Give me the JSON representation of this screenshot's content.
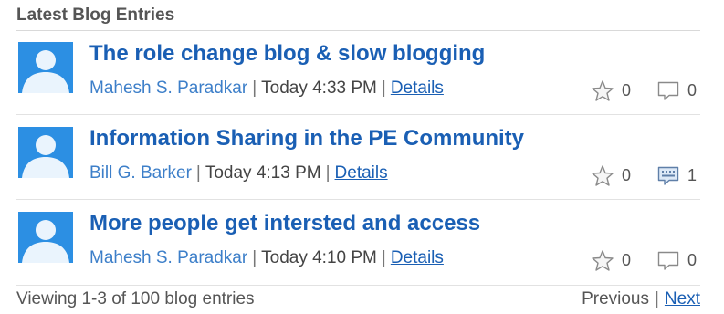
{
  "widget": {
    "title": "Latest Blog Entries"
  },
  "entries": [
    {
      "title": "The role change blog & slow blogging",
      "author": "Mahesh S. Paradkar",
      "time": "Today 4:33 PM",
      "details_label": "Details",
      "rating_count": "0",
      "comment_count": "0",
      "comment_icon": "comment-empty-icon"
    },
    {
      "title": "Information Sharing in the PE Community",
      "author": "Bill G. Barker",
      "time": "Today 4:13 PM",
      "details_label": "Details",
      "rating_count": "0",
      "comment_count": "1",
      "comment_icon": "comment-filled-icon"
    },
    {
      "title": "More people get intersted and access",
      "author": "Mahesh S. Paradkar",
      "time": "Today 4:10 PM",
      "details_label": "Details",
      "rating_count": "0",
      "comment_count": "0",
      "comment_icon": "comment-empty-icon"
    }
  ],
  "footer": {
    "viewing_text": "Viewing 1-3 of 100 blog entries",
    "previous_label": "Previous",
    "separator": "|",
    "next_label": "Next"
  },
  "colors": {
    "link": "#1a5fb4",
    "author": "#3d7fc9",
    "avatar_bg": "#2c8fe3"
  }
}
